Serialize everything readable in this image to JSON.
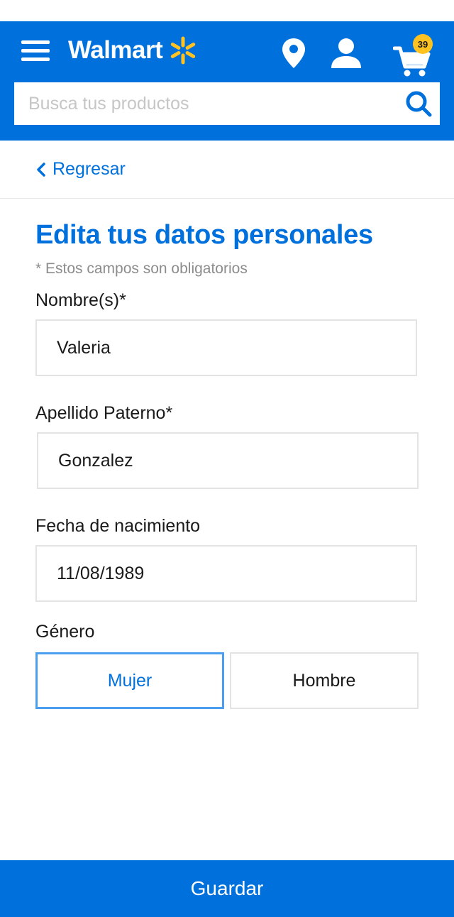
{
  "header": {
    "brand": "Walmart",
    "cart_count": "39",
    "search_placeholder": "Busca tus productos",
    "colors": {
      "header_bg": "#0071dc",
      "spark": "#ffc220",
      "badge": "#ffc220"
    },
    "icons": [
      "menu-icon",
      "spark-icon",
      "location-pin-icon",
      "user-icon",
      "cart-icon",
      "search-icon"
    ]
  },
  "nav": {
    "back_label": "Regresar"
  },
  "form": {
    "title": "Edita tus datos personales",
    "required_note": "* Estos campos son obligatorios",
    "first_name": {
      "label": "Nombre(s)*",
      "value": "Valeria"
    },
    "last_name": {
      "label": "Apellido Paterno*",
      "value": "Gonzalez"
    },
    "birthdate": {
      "label": "Fecha de nacimiento",
      "value": "11/08/1989"
    },
    "gender": {
      "label": "Género",
      "options": [
        "Mujer",
        "Hombre"
      ],
      "selected": "Mujer"
    }
  },
  "footer": {
    "save_label": "Guardar"
  }
}
